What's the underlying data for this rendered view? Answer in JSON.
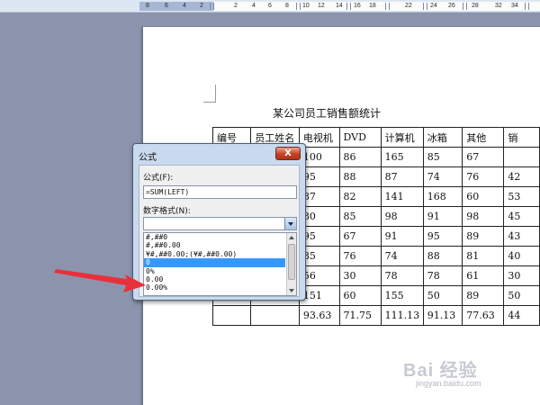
{
  "ruler": {
    "labels": [
      "8",
      "6",
      "4",
      "2",
      "2",
      "4",
      "6",
      "8",
      "10",
      "12",
      "14",
      "16",
      "18",
      "22",
      "24",
      "26",
      "28",
      "32",
      "34"
    ]
  },
  "document": {
    "title": "某公司员工销售额统计",
    "headers": [
      "编号",
      "员工姓名",
      "电视机",
      "DVD",
      "计算机",
      "冰箱",
      "其他",
      "销"
    ],
    "rows": [
      [
        "",
        "",
        "100",
        "86",
        "165",
        "85",
        "67",
        ""
      ],
      [
        "",
        "",
        "95",
        "88",
        "87",
        "74",
        "76",
        "42"
      ],
      [
        "",
        "",
        "87",
        "82",
        "141",
        "168",
        "60",
        "53"
      ],
      [
        "",
        "",
        "80",
        "85",
        "98",
        "91",
        "98",
        "45"
      ],
      [
        "",
        "",
        "95",
        "67",
        "91",
        "95",
        "89",
        "43"
      ],
      [
        "",
        "",
        "85",
        "76",
        "74",
        "88",
        "81",
        "40"
      ],
      [
        "",
        "",
        "56",
        "30",
        "78",
        "78",
        "61",
        "30"
      ],
      [
        "",
        "",
        "151",
        "60",
        "155",
        "50",
        "89",
        "50"
      ],
      [
        "",
        "",
        "93.63",
        "71.75",
        "111.13",
        "91.13",
        "77.63",
        "44"
      ]
    ]
  },
  "dialog": {
    "title": "公式",
    "close_label": "X",
    "formula_label": "公式(F):",
    "formula_value": "=SUM(LEFT)",
    "format_label": "数字格式(N):",
    "format_value": "",
    "format_options": [
      "#,##0",
      "#,##0.00",
      "¥#,##0.00;(¥#,##0.00)",
      "0",
      "0%",
      "0.00",
      "0.00%"
    ],
    "selected_index": 3
  },
  "overlay": {
    "arrow_color": "#e8303a"
  },
  "watermark": {
    "logo_text": "Bai 经验",
    "url": "jingyan.baidu.com"
  }
}
